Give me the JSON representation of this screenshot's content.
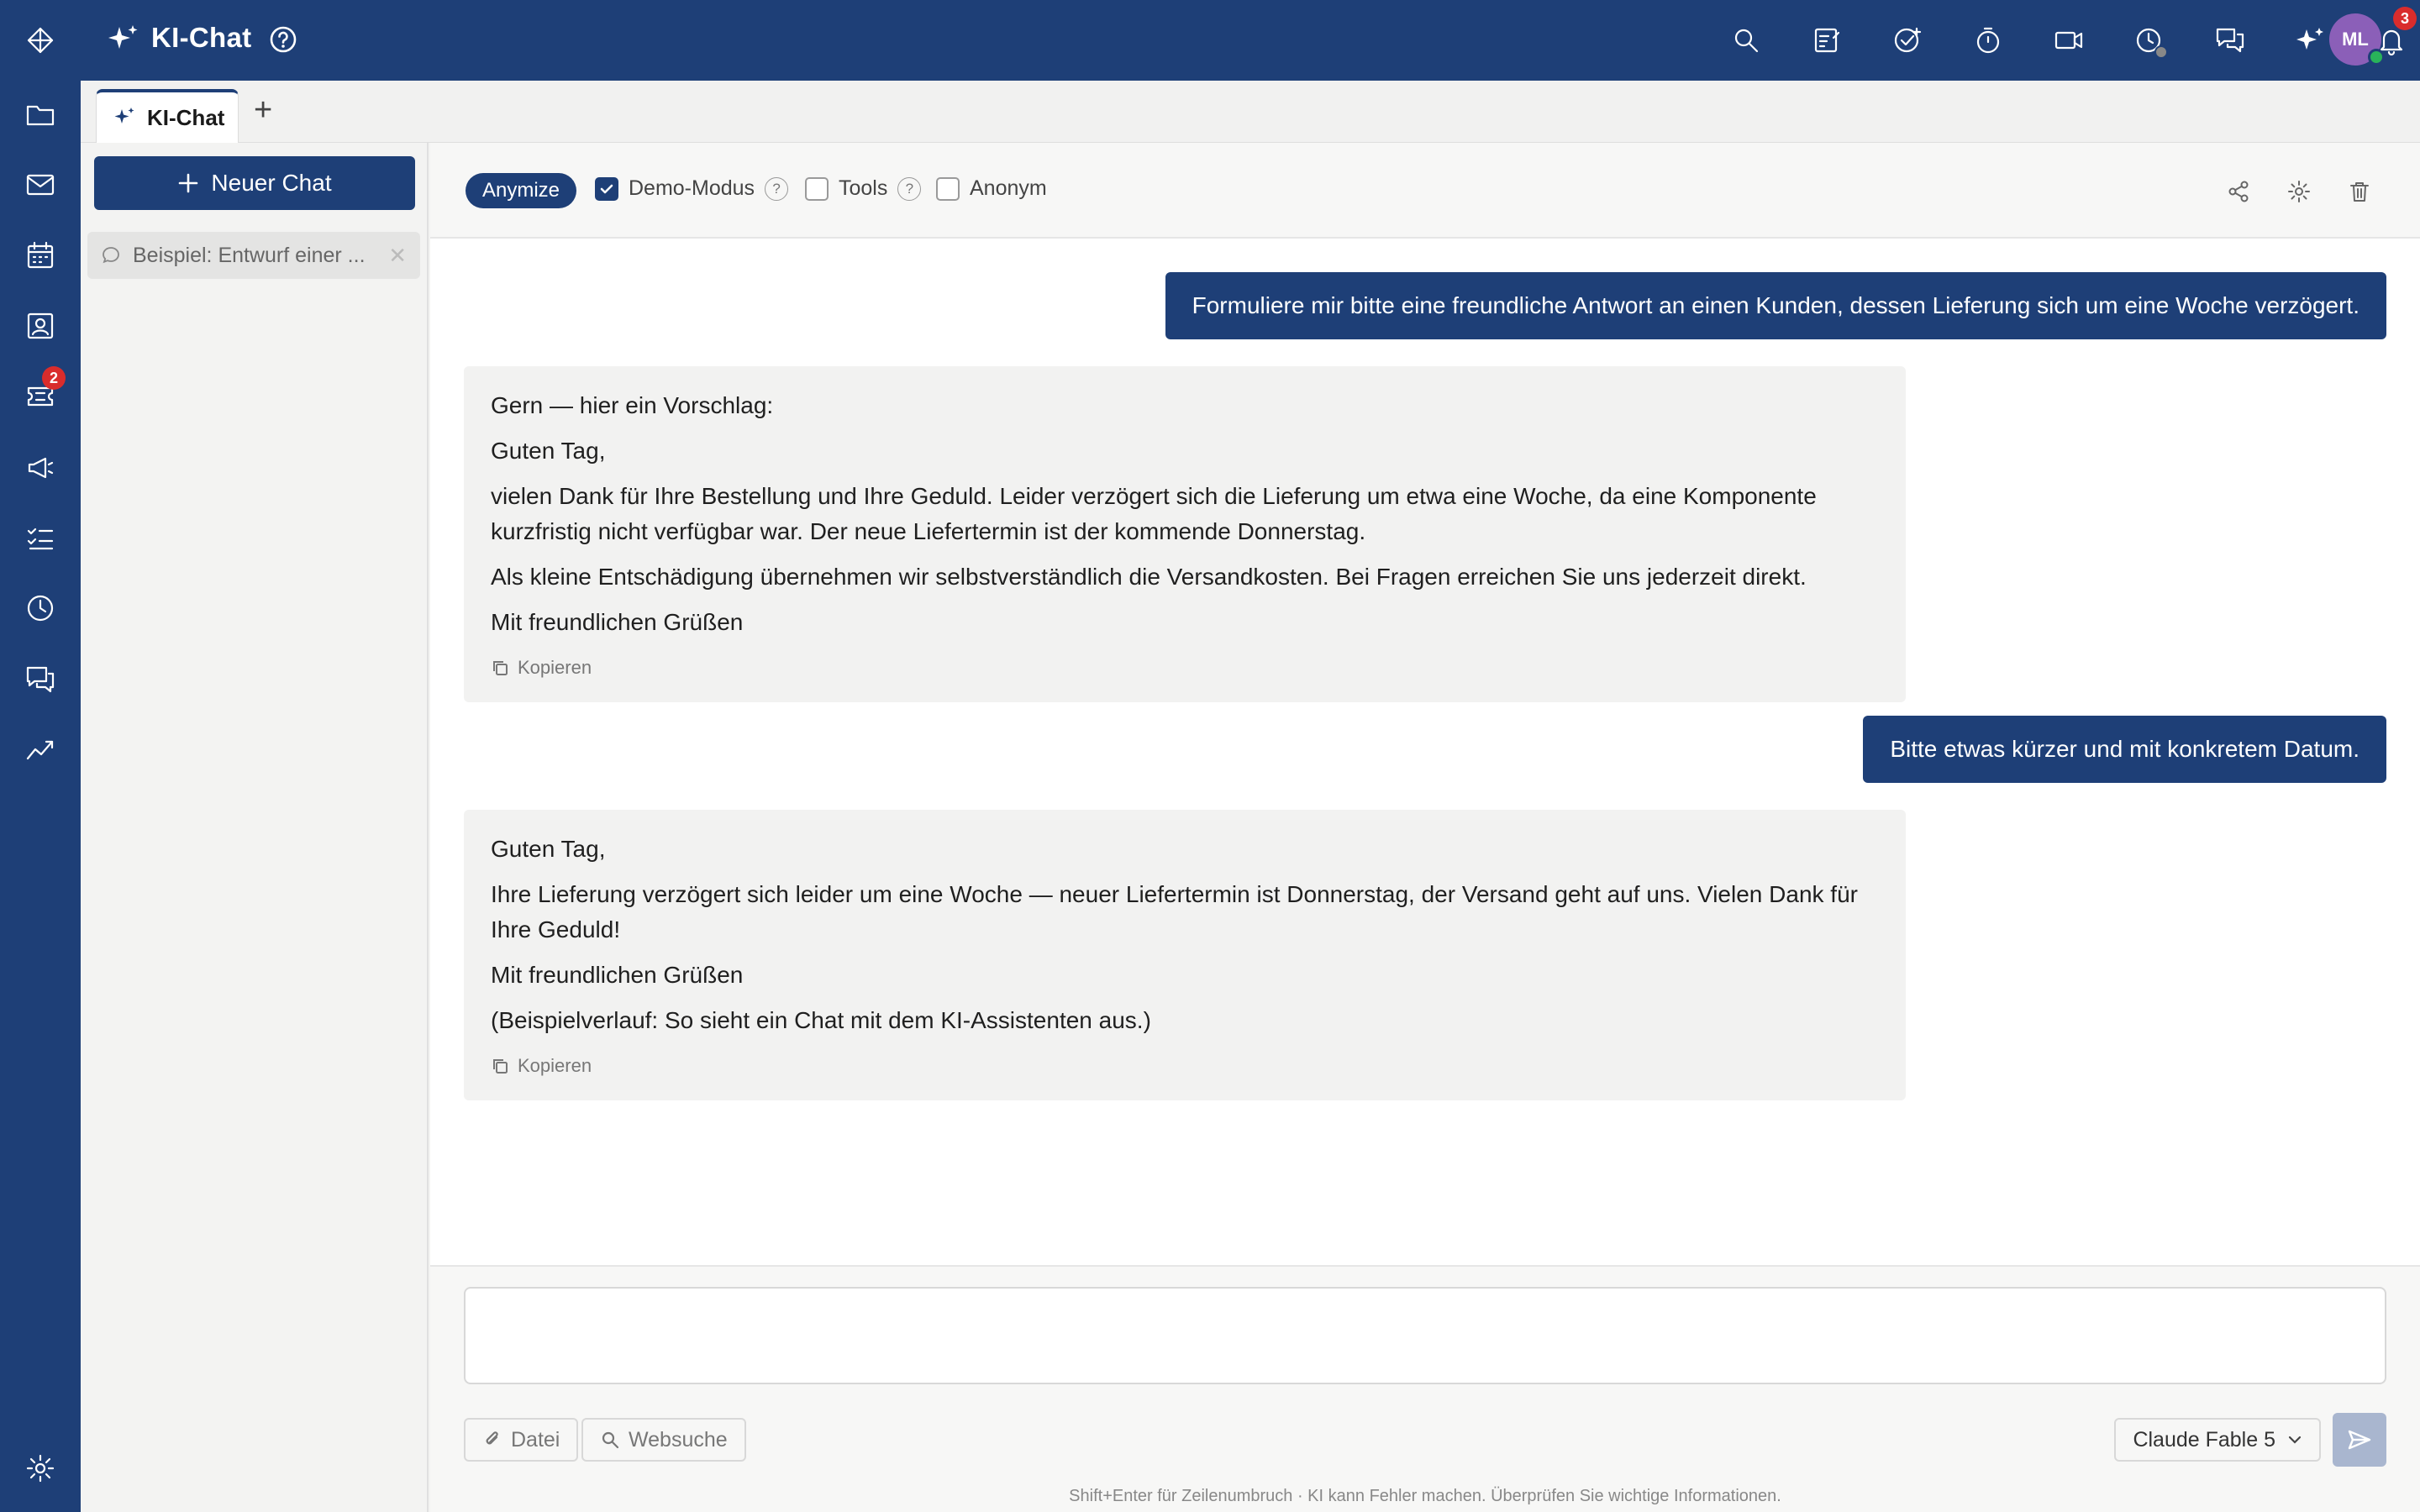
{
  "header": {
    "title": "KI-Chat",
    "avatar_initials": "ML",
    "notification_count": "3"
  },
  "rail": {
    "items": [
      "logo",
      "files",
      "mail",
      "calendar",
      "contacts",
      "tickets",
      "announcements",
      "tasks",
      "time",
      "messages",
      "analytics",
      "settings"
    ],
    "tickets_badge": "2"
  },
  "tabs": {
    "active": "KI-Chat",
    "add_symbol": "+"
  },
  "sidebar": {
    "new_chat_label": "Neuer Chat",
    "chats": [
      {
        "label": "Beispiel: Entwurf einer ..."
      }
    ]
  },
  "toolbar": {
    "anymize_label": "Anymize",
    "options": [
      {
        "label": "Demo-Modus",
        "checked": true,
        "help": "?"
      },
      {
        "label": "Tools",
        "checked": false,
        "help": "?"
      },
      {
        "label": "Anonym",
        "checked": false
      }
    ]
  },
  "messages": [
    {
      "role": "user",
      "text": "Formuliere mir bitte eine freundliche Antwort an einen Kunden, dessen Lieferung sich um eine Woche verzögert."
    },
    {
      "role": "assistant",
      "paragraphs": [
        "Gern — hier ein Vorschlag:",
        "Guten Tag,",
        "vielen Dank für Ihre Bestellung und Ihre Geduld. Leider verzögert sich die Lieferung um etwa eine Woche, da eine Komponente kurzfristig nicht verfügbar war. Der neue Liefertermin ist der kommende Donnerstag.",
        "Als kleine Entschädigung übernehmen wir selbstverständlich die Versandkosten. Bei Fragen erreichen Sie uns jederzeit direkt.",
        "Mit freundlichen Grüßen"
      ],
      "copy_label": "Kopieren"
    },
    {
      "role": "user",
      "text": "Bitte etwas kürzer und mit konkretem Datum."
    },
    {
      "role": "assistant",
      "paragraphs": [
        "Guten Tag,",
        "Ihre Lieferung verzögert sich leider um eine Woche — neuer Liefertermin ist Donnerstag, der Versand geht auf uns. Vielen Dank für Ihre Geduld!",
        "Mit freundlichen Grüßen",
        "(Beispielverlauf: So sieht ein Chat mit dem KI-Assistenten aus.)"
      ],
      "copy_label": "Kopieren"
    }
  ],
  "composer": {
    "placeholder": "",
    "file_label": "Datei",
    "websearch_label": "Websuche",
    "model_label": "Claude Fable 5",
    "hint": "Shift+Enter für Zeilenumbruch · KI kann Fehler machen. Überprüfen Sie wichtige Informationen."
  },
  "colors": {
    "brand": "#1e3f77",
    "badge": "#d92c2c",
    "avatar": "#8b5fb8",
    "presence": "#29b35a"
  }
}
